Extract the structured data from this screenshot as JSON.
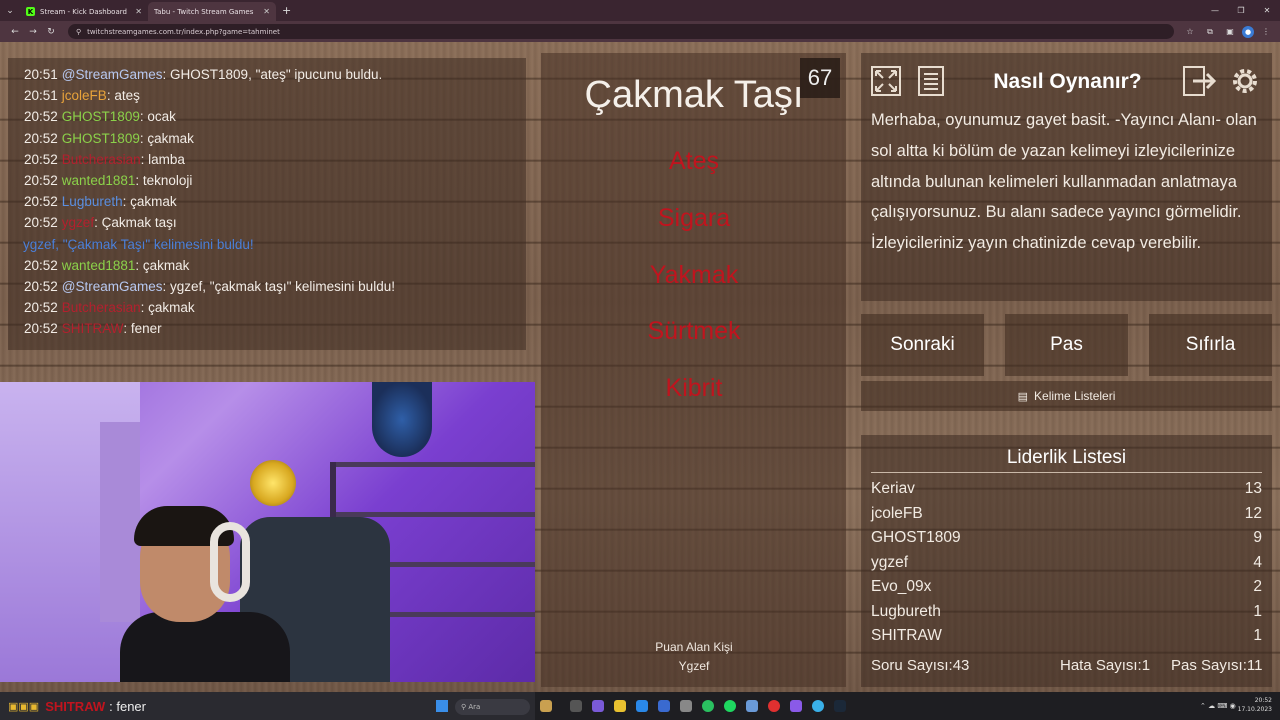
{
  "browser": {
    "tabs": [
      {
        "label": "Stream - Kick Dashboard",
        "icon": "kick-icon",
        "active": false
      },
      {
        "label": "Tabu - Twitch Stream Games",
        "icon": "page-icon",
        "active": true
      }
    ],
    "url": "twitchstreamgames.com.tr/index.php?game=tahminet"
  },
  "chat": {
    "messages": [
      {
        "time": "20:51",
        "user": "@StreamGames",
        "user_color": "stream",
        "text": ": GHOST1809, \"ateş\" ipucunu buldu."
      },
      {
        "time": "20:51",
        "user": "jcoleFB",
        "user_color": "orange",
        "text": ": ateş"
      },
      {
        "time": "20:52",
        "user": "GHOST1809",
        "user_color": "green",
        "text": ": ocak"
      },
      {
        "time": "20:52",
        "user": "GHOST1809",
        "user_color": "green",
        "text": ": çakmak"
      },
      {
        "time": "20:52",
        "user": "Butcherasian",
        "user_color": "red",
        "text": ": lamba"
      },
      {
        "time": "20:52",
        "user": "wanted1881",
        "user_color": "green",
        "text": ": teknoloji"
      },
      {
        "time": "20:52",
        "user": "Lugbureth",
        "user_color": "blue",
        "text": ": çakmak"
      },
      {
        "time": "20:52",
        "user": "ygzef",
        "user_color": "red",
        "text": ": Çakmak taşı"
      },
      {
        "time": "",
        "user": "",
        "user_color": "",
        "text": "ygzef, \"Çakmak Taşı\" kelimesini buldu!",
        "notice": true
      },
      {
        "time": "20:52",
        "user": "wanted1881",
        "user_color": "green",
        "text": ": çakmak"
      },
      {
        "time": "20:52",
        "user": "@StreamGames",
        "user_color": "stream",
        "text": ": ygzef, \"çakmak taşı\" kelimesini buldu!"
      },
      {
        "time": "20:52",
        "user": "Butcherasian",
        "user_color": "red",
        "text": ": çakmak"
      },
      {
        "time": "20:52",
        "user": "SHITRAW",
        "user_color": "red",
        "text": ": fener"
      }
    ]
  },
  "card": {
    "timer": "67",
    "word": "Çakmak Taşı",
    "taboo": [
      "Ateş",
      "Sigara",
      "Yakmak",
      "Sürtmek",
      "Kibrit"
    ],
    "scorer_label": "Puan Alan Kişi",
    "scorer_name": "Ygzef"
  },
  "howto": {
    "title": "Nasıl Oynanır?",
    "text": "Merhaba, oyunumuz gayet basit. -Yayıncı Alanı- olan sol altta ki bölüm de yazan kelimeyi izleyicilerinize altında bulunan kelimeleri kullanmadan anlatmaya çalışıyorsunuz. Bu alanı sadece yayıncı görmelidir. İzleyicileriniz yayın chatinizde cevap verebilir."
  },
  "buttons": {
    "next": "Sonraki",
    "pass": "Pas",
    "reset": "Sıfırla",
    "word_lists": "Kelime Listeleri"
  },
  "leaderboard": {
    "title": "Liderlik Listesi",
    "rows": [
      {
        "name": "Keriav",
        "score": "13"
      },
      {
        "name": "jcoleFB",
        "score": "12"
      },
      {
        "name": "GHOST1809",
        "score": "9"
      },
      {
        "name": "ygzef",
        "score": "4"
      },
      {
        "name": "Evo_09x",
        "score": "2"
      },
      {
        "name": "Lugbureth",
        "score": "1"
      },
      {
        "name": "SHITRAW",
        "score": "1"
      }
    ],
    "questions_label": "Soru Sayısı:43",
    "errors_label": "Hata Sayısı:1",
    "passes_label": "Pas Sayısı:11"
  },
  "ticker": {
    "user": "SHITRAW",
    "text": ": fener"
  },
  "taskbar": {
    "search_placeholder": "Ara",
    "time": "20:52",
    "date": "17.10.2023"
  },
  "colors": {
    "taboo_red": "#c0141e",
    "stream_user": "#b7c8f0",
    "notice_blue": "#4a7fd8"
  }
}
